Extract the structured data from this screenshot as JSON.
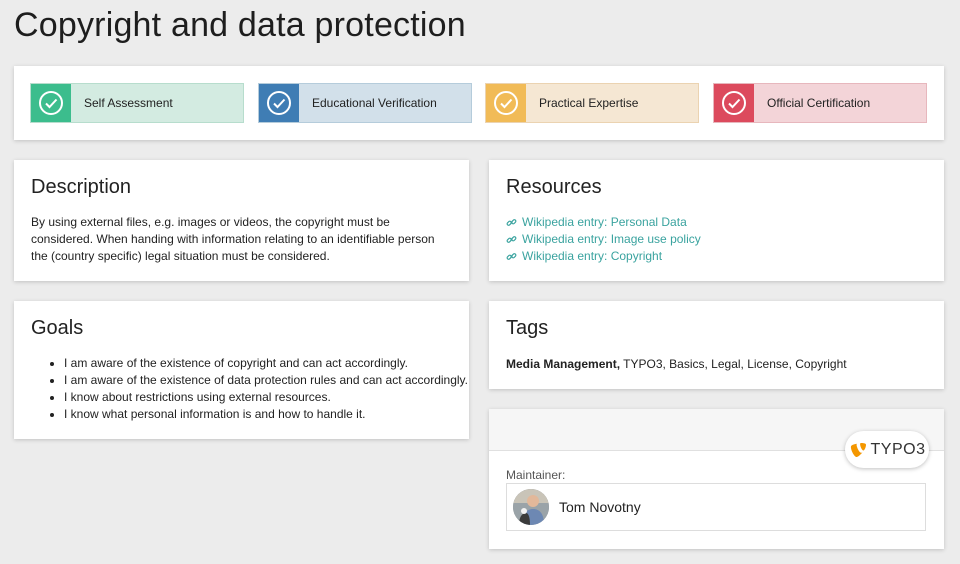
{
  "page": {
    "title": "Copyright and data protection"
  },
  "levels": [
    {
      "label": "Self Assessment",
      "color": "#3cbd8d",
      "icon": "check-circle-icon"
    },
    {
      "label": "Educational Verification",
      "color": "#3f7db4",
      "icon": "check-circle-icon"
    },
    {
      "label": "Practical Expertise",
      "color": "#f1bb57",
      "icon": "check-circle-icon"
    },
    {
      "label": "Official Certification",
      "color": "#dc4a5d",
      "icon": "check-circle-icon"
    }
  ],
  "description": {
    "heading": "Description",
    "text": "By using external files, e.g. images or videos, the copyright must be considered. When handing with information relating to an identifiable person the (country specific) legal situation must be considered."
  },
  "goals": {
    "heading": "Goals",
    "items": [
      "I am aware of the existence of copyright and can act accordingly.",
      "I am aware of the existence of data protection rules and can act accordingly.",
      "I know about restrictions using external resources.",
      "I know what personal information is and how to handle it."
    ]
  },
  "resources": {
    "heading": "Resources",
    "links": [
      "Wikipedia entry: Personal Data",
      "Wikipedia entry: Image use policy",
      "Wikipedia entry: Copyright"
    ]
  },
  "tags": {
    "heading": "Tags",
    "primary": "Media Management,",
    "rest": " TYPO3, Basics, Legal, License, Copyright"
  },
  "maintainer": {
    "badge": "TYPO3",
    "label": "Maintainer:",
    "name": "Tom Novotny"
  }
}
